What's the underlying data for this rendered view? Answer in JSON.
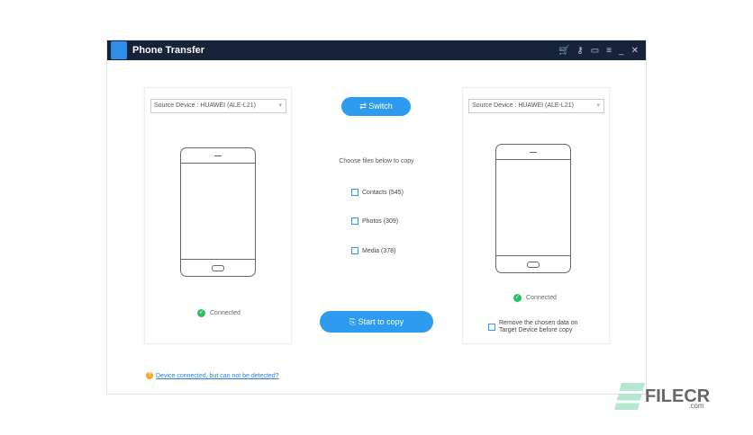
{
  "title": "Phone Transfer",
  "left": {
    "device": "Source Device : HUAWEI (ALE-L21)",
    "status": "Connected"
  },
  "right": {
    "device": "Source Device : HUAWEI (ALE-L21)",
    "status": "Connected",
    "remove_label": "Remove the chosen data on Target Device before copy"
  },
  "switch_label": "Switch",
  "choose_label": "Choose files below to copy",
  "files": [
    "Contacts (545)",
    "Photos (309)",
    "Media (378)"
  ],
  "start_label": "Start to copy",
  "help_link": "Device connected, but can not be detected?",
  "watermark": {
    "brand": "FILECR",
    "suffix": ".com"
  }
}
